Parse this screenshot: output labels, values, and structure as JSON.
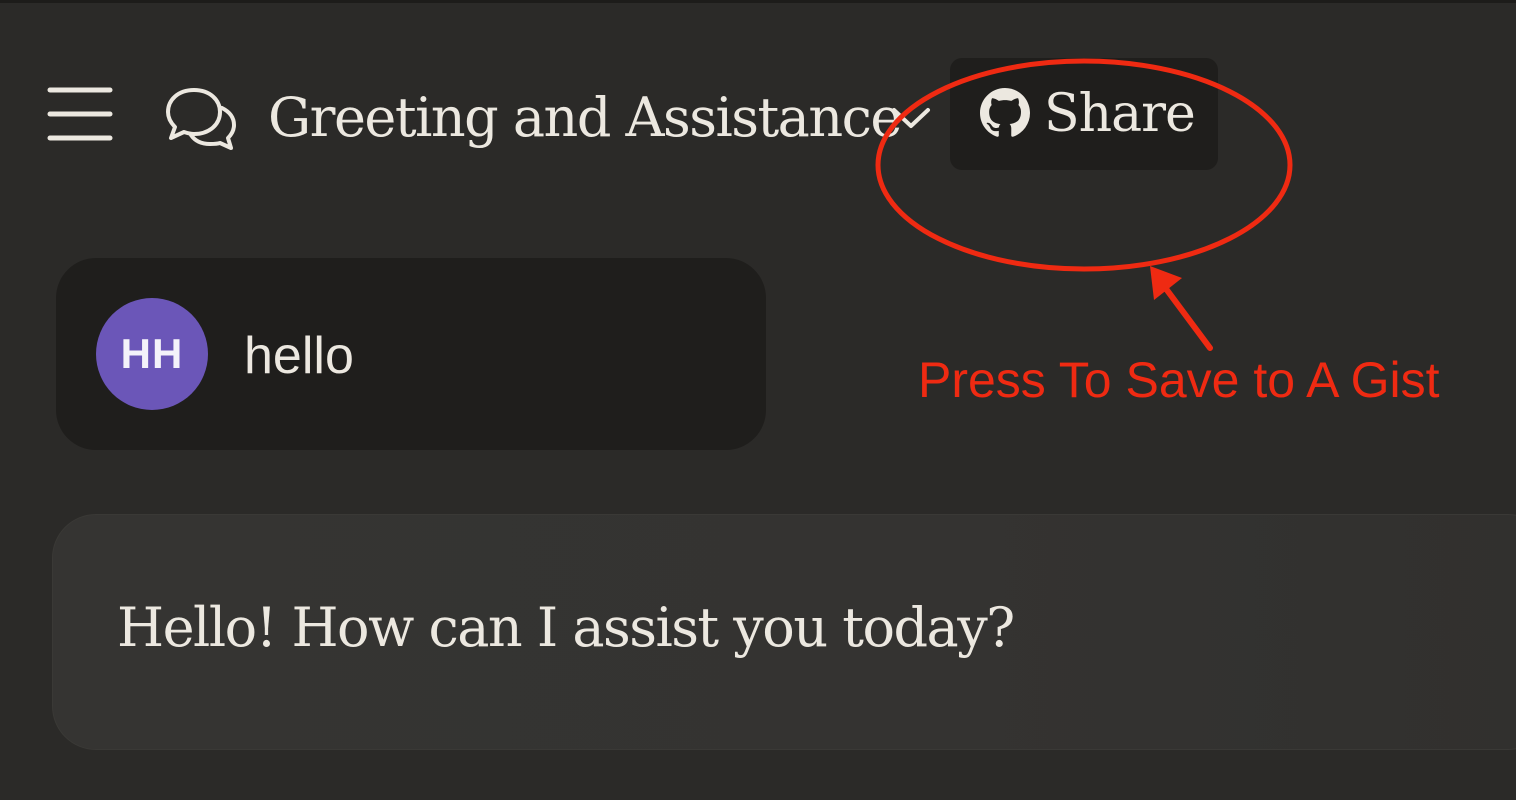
{
  "header": {
    "menu_icon": "hamburger-menu-icon",
    "chat_icon": "chat-bubbles-icon",
    "conversation_title": "Greeting and Assistance",
    "chevron_icon": "chevron-down-icon",
    "share_button": {
      "icon": "github-icon",
      "label": "Share"
    }
  },
  "annotation": {
    "text": "Press To Save to A Gist",
    "color": "#ef2a12"
  },
  "messages": [
    {
      "role": "user",
      "avatar_initials": "HH",
      "avatar_color": "#6b56b8",
      "text": "hello"
    },
    {
      "role": "assistant",
      "text": "Hello! How can I assist you today?"
    }
  ],
  "colors": {
    "background": "#2b2a28",
    "user_bubble": "#1f1e1c",
    "assistant_bubble": "#353432",
    "text": "#ece8e0"
  }
}
